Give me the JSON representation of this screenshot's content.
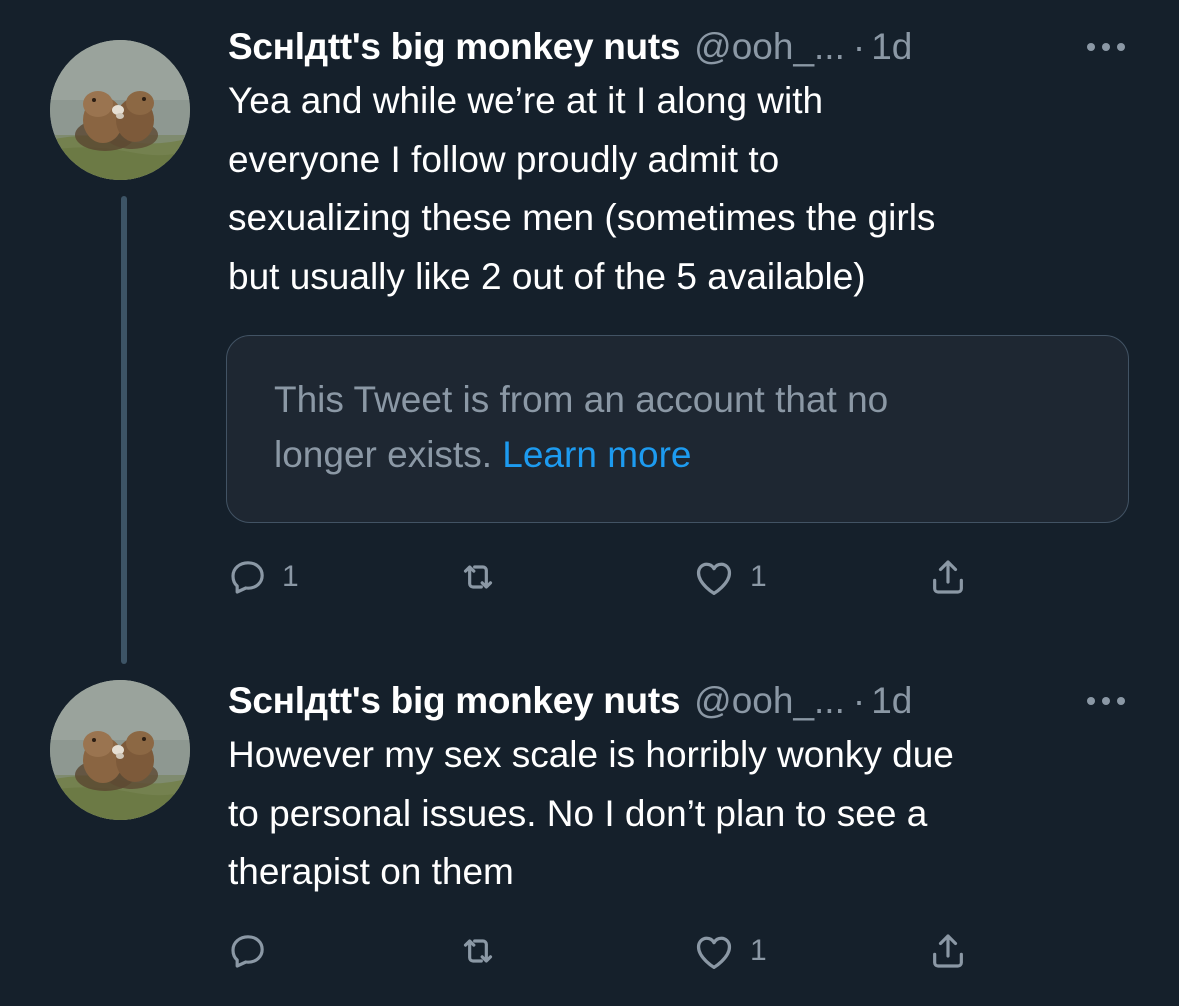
{
  "tweets": [
    {
      "display_name": "Scнlдtt's big monkey nuts",
      "handle": "@ooh_...",
      "separator": "·",
      "time": "1d",
      "text": "Yea and while we’re at it I along with\neveryone I follow proudly admit to\nsexualizing these men (sometimes the girls\nbut usually like 2 out of the 5 available)",
      "quote": {
        "text": "This Tweet is from an account that no\nlonger exists. ",
        "link": "Learn more"
      },
      "reply_count": "1",
      "retweet_count": "",
      "like_count": "1"
    },
    {
      "display_name": "Scнlдtt's big monkey nuts",
      "handle": "@ooh_...",
      "separator": "·",
      "time": "1d",
      "text": "However my sex scale is horribly wonky due\nto personal issues. No I don’t plan to see a\ntherapist on them",
      "reply_count": "",
      "retweet_count": "",
      "like_count": "1"
    }
  ],
  "icons": {
    "reply": "reply-icon",
    "retweet": "retweet-icon",
    "like": "heart-icon",
    "share": "share-icon",
    "more": "more-options-icon"
  },
  "colors": {
    "background": "#15202b",
    "primary_text": "#ffffff",
    "secondary_text": "#8b98a5",
    "link": "#1d9bf0",
    "thread_line": "#3d5466",
    "quote_border": "#425364"
  }
}
